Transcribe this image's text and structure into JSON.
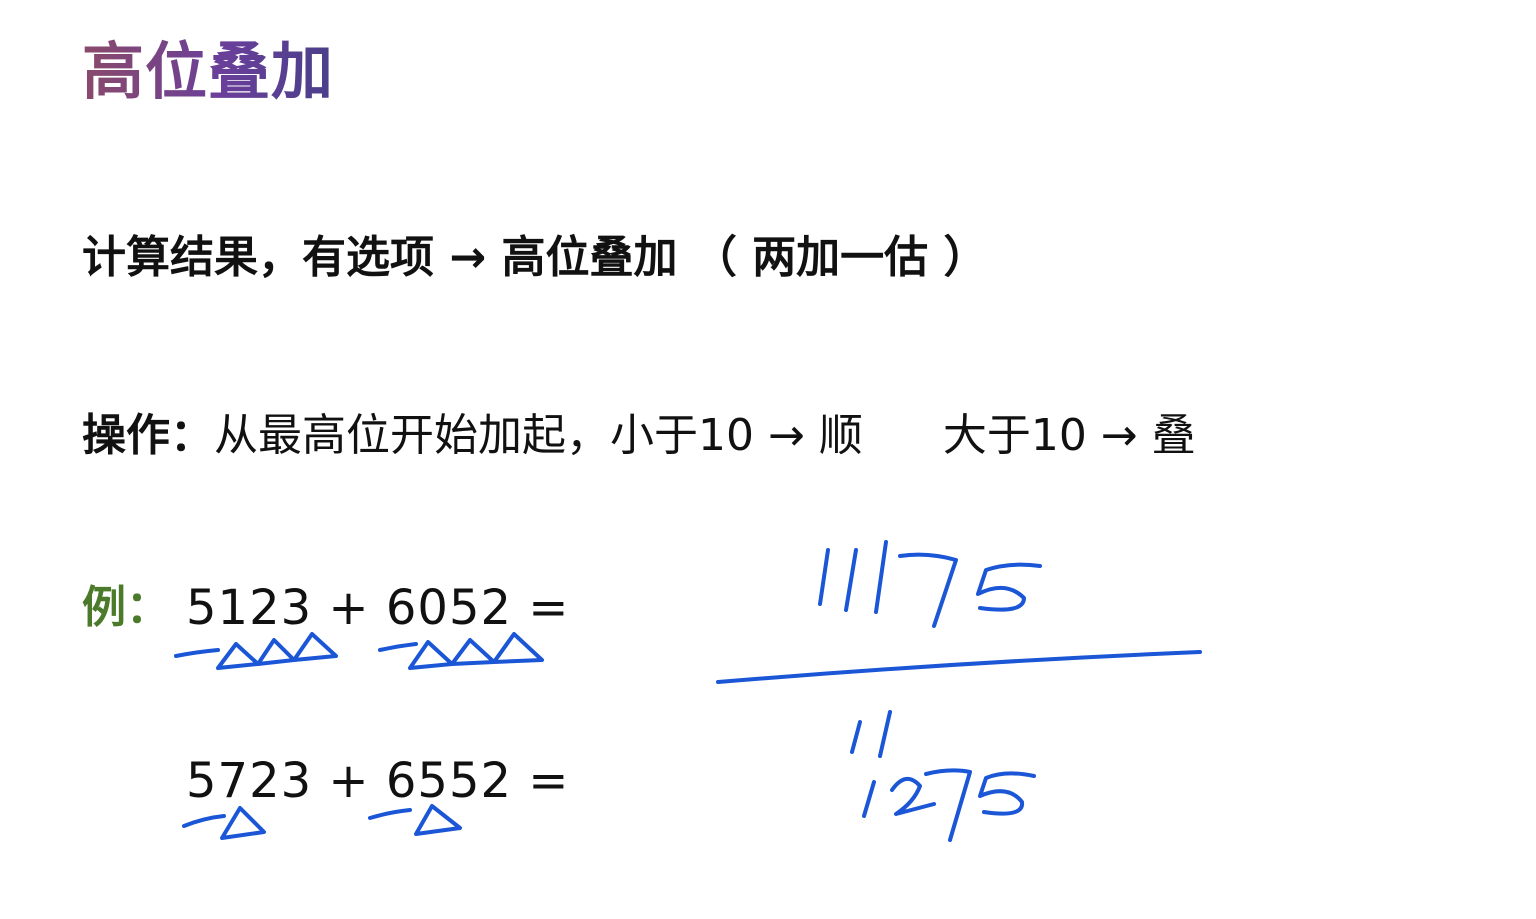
{
  "title": "高位叠加",
  "rule": {
    "text": "计算结果，有选项 → 高位叠加 （ 两加一估 ）"
  },
  "operation": {
    "label": "操作：",
    "text_a": "从最高位开始加起，小于10 → 顺",
    "text_b": "大于10 → 叠"
  },
  "example": {
    "label": "例：",
    "expr1": "5123 + 6052 =",
    "expr2": "5723 + 6552 ="
  },
  "handwriting": {
    "ink_color": "#1a56d6",
    "result1": "11175",
    "carry": "11",
    "result2": "1275"
  }
}
